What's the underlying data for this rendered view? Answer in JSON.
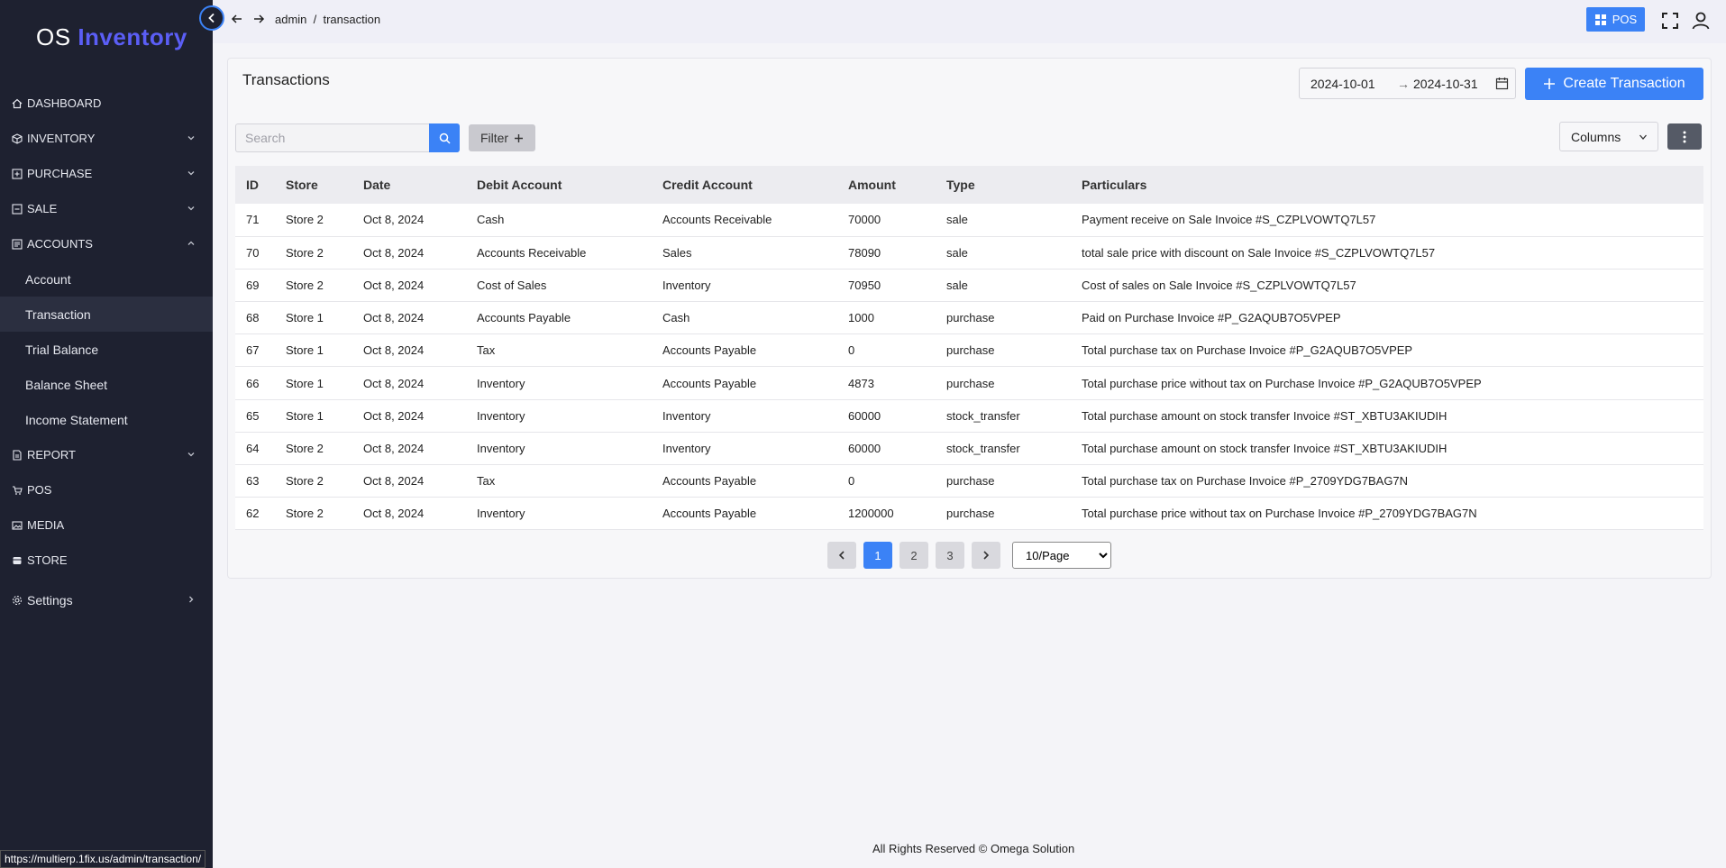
{
  "app": {
    "logo_os": "OS",
    "logo_name": "Inventory"
  },
  "sidebar": {
    "items": [
      {
        "label": "DASHBOARD",
        "icon": "home-icon"
      },
      {
        "label": "INVENTORY",
        "icon": "cube-icon"
      },
      {
        "label": "PURCHASE",
        "icon": "plus-square-icon"
      },
      {
        "label": "SALE",
        "icon": "minus-square-icon"
      },
      {
        "label": "ACCOUNTS",
        "icon": "ledger-icon"
      }
    ],
    "accounts_sub": [
      "Account",
      "Transaction",
      "Trial Balance",
      "Balance Sheet",
      "Income Statement"
    ],
    "items2": [
      {
        "label": "REPORT",
        "icon": "report-icon"
      },
      {
        "label": "POS",
        "icon": "cart-icon"
      },
      {
        "label": "MEDIA",
        "icon": "image-icon"
      },
      {
        "label": "STORE",
        "icon": "store-icon"
      }
    ],
    "settings": "Settings"
  },
  "topbar": {
    "breadcrumb": "admin  /  transaction",
    "pos_label": "POS"
  },
  "page": {
    "title": "Transactions",
    "date_from": "2024-10-01",
    "date_to": "2024-10-31",
    "create_label": "Create Transaction",
    "search_placeholder": "Search",
    "filter_label": "Filter",
    "columns_label": "Columns"
  },
  "table": {
    "headers": [
      "ID",
      "Store",
      "Date",
      "Debit Account",
      "Credit Account",
      "Amount",
      "Type",
      "Particulars"
    ],
    "rows": [
      [
        "71",
        "Store 2",
        "Oct 8, 2024",
        "Cash",
        "Accounts Receivable",
        "70000",
        "sale",
        "Payment receive on Sale Invoice #S_CZPLVOWTQ7L57"
      ],
      [
        "70",
        "Store 2",
        "Oct 8, 2024",
        "Accounts Receivable",
        "Sales",
        "78090",
        "sale",
        "total sale price with discount on Sale Invoice #S_CZPLVOWTQ7L57"
      ],
      [
        "69",
        "Store 2",
        "Oct 8, 2024",
        "Cost of Sales",
        "Inventory",
        "70950",
        "sale",
        "Cost of sales on Sale Invoice #S_CZPLVOWTQ7L57"
      ],
      [
        "68",
        "Store 1",
        "Oct 8, 2024",
        "Accounts Payable",
        "Cash",
        "1000",
        "purchase",
        "Paid on Purchase Invoice #P_G2AQUB7O5VPEP"
      ],
      [
        "67",
        "Store 1",
        "Oct 8, 2024",
        "Tax",
        "Accounts Payable",
        "0",
        "purchase",
        "Total purchase tax on Purchase Invoice #P_G2AQUB7O5VPEP"
      ],
      [
        "66",
        "Store 1",
        "Oct 8, 2024",
        "Inventory",
        "Accounts Payable",
        "4873",
        "purchase",
        "Total purchase price without tax on Purchase Invoice #P_G2AQUB7O5VPEP"
      ],
      [
        "65",
        "Store 1",
        "Oct 8, 2024",
        "Inventory",
        "Inventory",
        "60000",
        "stock_transfer",
        "Total purchase amount on stock transfer Invoice #ST_XBTU3AKIUDIH"
      ],
      [
        "64",
        "Store 2",
        "Oct 8, 2024",
        "Inventory",
        "Inventory",
        "60000",
        "stock_transfer",
        "Total purchase amount on stock transfer Invoice #ST_XBTU3AKIUDIH"
      ],
      [
        "63",
        "Store 2",
        "Oct 8, 2024",
        "Tax",
        "Accounts Payable",
        "0",
        "purchase",
        "Total purchase tax on Purchase Invoice #P_2709YDG7BAG7N"
      ],
      [
        "62",
        "Store 2",
        "Oct 8, 2024",
        "Inventory",
        "Accounts Payable",
        "1200000",
        "purchase",
        "Total purchase price without tax on Purchase Invoice #P_2709YDG7BAG7N"
      ]
    ]
  },
  "pagination": {
    "pages": [
      "1",
      "2",
      "3"
    ],
    "current": "1",
    "per_page": "10/Page"
  },
  "footer": "All Rights Reserved © Omega Solution",
  "status_url": "https://multierp.1fix.us/admin/transaction/",
  "colors": {
    "primary": "#3b82f6",
    "sidebar_bg": "#1e2130",
    "brand": "#5b5ef6"
  }
}
